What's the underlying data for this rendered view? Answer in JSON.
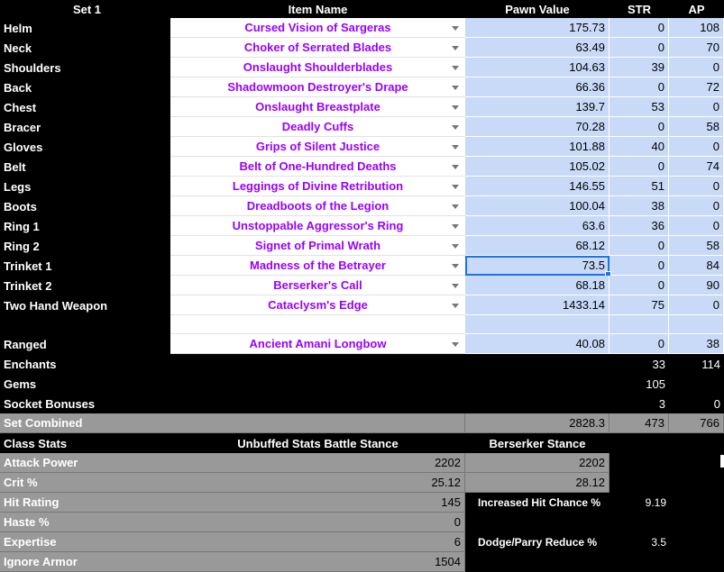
{
  "headers": {
    "set": "Set 1",
    "item": "Item Name",
    "pawn": "Pawn Value",
    "str": "STR",
    "ap": "AP"
  },
  "gear": [
    {
      "slot": "Helm",
      "item": "Cursed Vision of Sargeras",
      "pawn": "175.73",
      "str": "0",
      "ap": "108"
    },
    {
      "slot": "Neck",
      "item": "Choker of Serrated Blades",
      "pawn": "63.49",
      "str": "0",
      "ap": "70"
    },
    {
      "slot": "Shoulders",
      "item": "Onslaught Shoulderblades",
      "pawn": "104.63",
      "str": "39",
      "ap": "0"
    },
    {
      "slot": "Back",
      "item": "Shadowmoon Destroyer's Drape",
      "pawn": "66.36",
      "str": "0",
      "ap": "72"
    },
    {
      "slot": "Chest",
      "item": "Onslaught Breastplate",
      "pawn": "139.7",
      "str": "53",
      "ap": "0"
    },
    {
      "slot": "Bracer",
      "item": "Deadly Cuffs",
      "pawn": "70.28",
      "str": "0",
      "ap": "58"
    },
    {
      "slot": "Gloves",
      "item": "Grips of Silent Justice",
      "pawn": "101.88",
      "str": "40",
      "ap": "0"
    },
    {
      "slot": "Belt",
      "item": "Belt of One-Hundred Deaths",
      "pawn": "105.02",
      "str": "0",
      "ap": "74"
    },
    {
      "slot": "Legs",
      "item": "Leggings of Divine Retribution",
      "pawn": "146.55",
      "str": "51",
      "ap": "0"
    },
    {
      "slot": "Boots",
      "item": "Dreadboots of the Legion",
      "pawn": "100.04",
      "str": "38",
      "ap": "0"
    },
    {
      "slot": "Ring 1",
      "item": "Unstoppable Aggressor's Ring",
      "pawn": "63.6",
      "str": "36",
      "ap": "0"
    },
    {
      "slot": "Ring 2",
      "item": "Signet of Primal Wrath",
      "pawn": "68.12",
      "str": "0",
      "ap": "58"
    },
    {
      "slot": "Trinket 1",
      "item": "Madness of the Betrayer",
      "pawn": "73.5",
      "str": "0",
      "ap": "84"
    },
    {
      "slot": "Trinket 2",
      "item": "Berserker's Call",
      "pawn": "68.18",
      "str": "0",
      "ap": "90"
    },
    {
      "slot": "Two Hand Weapon",
      "item": "Cataclysm's Edge",
      "pawn": "1433.14",
      "str": "75",
      "ap": "0"
    }
  ],
  "ranged": {
    "slot": "Ranged",
    "item": "Ancient Amani Longbow",
    "pawn": "40.08",
    "str": "0",
    "ap": "38"
  },
  "enchants": {
    "label": "Enchants",
    "str": "33",
    "ap": "114"
  },
  "gems": {
    "label": "Gems",
    "str": "105"
  },
  "socket_bonuses": {
    "label": "Socket Bonuses",
    "str": "3",
    "ap": "0"
  },
  "set_combined": {
    "label": "Set Combined",
    "pawn": "2828.3",
    "str": "473",
    "ap": "766"
  },
  "class_stats": {
    "label": "Class Stats",
    "unbuffed_header": "Unbuffed Stats Battle Stance",
    "berserker_header": "Berserker Stance"
  },
  "stats": [
    {
      "label": "Attack Power",
      "unbuffed": "2202",
      "berserker": "2202"
    },
    {
      "label": "Crit %",
      "unbuffed": "25.12",
      "berserker": "28.12"
    },
    {
      "label": "Hit Rating",
      "unbuffed": "145",
      "extra_label": "Increased Hit Chance %",
      "extra_value": "9.19"
    },
    {
      "label": "Haste %",
      "unbuffed": "0"
    },
    {
      "label": "Expertise",
      "unbuffed": "6",
      "extra_label": "Dodge/Parry Reduce %",
      "extra_value": "3.5"
    },
    {
      "label": "Ignore Armor",
      "unbuffed": "1504"
    }
  ],
  "colors": {
    "item_text": "#9900ff",
    "pawn_fill": "#c9daf8",
    "summary_fill": "#999999",
    "selection": "#1a73e8"
  }
}
